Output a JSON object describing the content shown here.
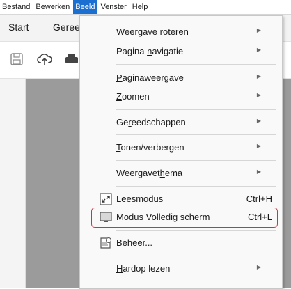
{
  "menubar": {
    "items": [
      "Bestand",
      "Bewerken",
      "Beeld",
      "Venster",
      "Help"
    ],
    "active": "Beeld"
  },
  "tabs": {
    "start": "Start",
    "tools": "Geree"
  },
  "menu": {
    "rotate": {
      "pre": "W",
      "u": "e",
      "post": "ergave roteren"
    },
    "page_nav": {
      "pre": "Pagina ",
      "u": "n",
      "post": "avigatie"
    },
    "page_display": {
      "pre": "",
      "u": "P",
      "post": "aginaweergave"
    },
    "zoom": {
      "pre": "",
      "u": "Z",
      "post": "oomen"
    },
    "tools": {
      "pre": "Ge",
      "u": "r",
      "post": "eedschappen"
    },
    "show_hide": {
      "pre": "",
      "u": "T",
      "post": "onen/verbergen"
    },
    "theme": {
      "pre": "Weergavet",
      "u": "h",
      "post": "ema"
    },
    "read_mode": {
      "pre": "Leesmo",
      "u": "d",
      "post": "us",
      "shortcut": "Ctrl+H"
    },
    "full_screen": {
      "pre": "Modus ",
      "u": "V",
      "post": "olledig scherm",
      "shortcut": "Ctrl+L"
    },
    "manage": {
      "pre": "",
      "u": "B",
      "post": "eheer..."
    },
    "read_aloud": {
      "pre": "",
      "u": "H",
      "post": "ardop lezen"
    }
  },
  "icons": {
    "save": "save-icon",
    "upload": "cloud-upload-icon",
    "print": "print-icon",
    "read_mode": "read-mode-icon",
    "full_screen": "full-screen-icon",
    "manage": "manage-icon",
    "submenu": "chevron-right-icon"
  },
  "colors": {
    "menu_active": "#1a6fd0",
    "highlight": "#d0343a",
    "canvas": "#9b9b9b"
  }
}
